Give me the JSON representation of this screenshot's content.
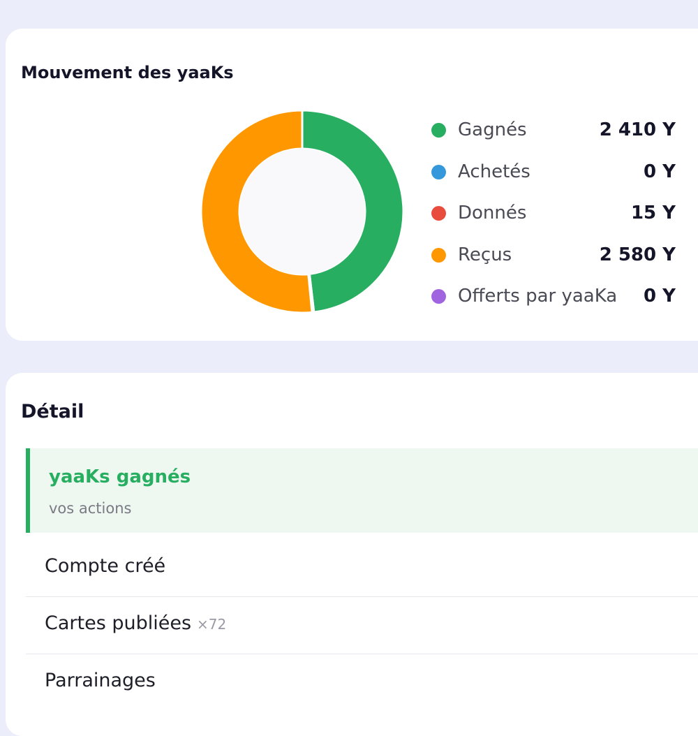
{
  "movement": {
    "title": "Mouvement des yaaKs",
    "legend": [
      {
        "label": "Gagnés",
        "value": "2 410 Y",
        "color": "#27ae60"
      },
      {
        "label": "Achetés",
        "value": "0 Y",
        "color": "#3498db"
      },
      {
        "label": "Donnés",
        "value": "15 Y",
        "color": "#e74c3c"
      },
      {
        "label": "Reçus",
        "value": "2 580 Y",
        "color": "#ff9800"
      },
      {
        "label": "Offerts par yaaKa",
        "value": "0 Y",
        "color": "#a064e0"
      }
    ]
  },
  "chart_data": {
    "type": "pie",
    "labels": [
      "Gagnés",
      "Achetés",
      "Donnés",
      "Reçus",
      "Offerts par yaaKa"
    ],
    "values": [
      2410,
      0,
      15,
      2580,
      0
    ],
    "colors": [
      "#27ae60",
      "#3498db",
      "#e74c3c",
      "#ff9800",
      "#a064e0"
    ],
    "donut": true
  },
  "detail": {
    "title": "Détail",
    "earned": {
      "title": "yaaKs gagnés",
      "subtitle": "vos actions"
    },
    "items": [
      {
        "label": "Compte créé",
        "count": ""
      },
      {
        "label": "Cartes publiées",
        "count": "×72"
      },
      {
        "label": "Parrainages",
        "count": ""
      }
    ]
  }
}
